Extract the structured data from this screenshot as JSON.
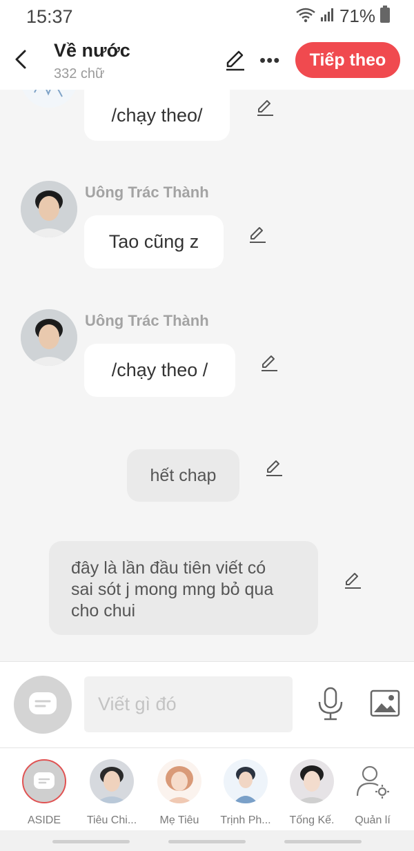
{
  "status": {
    "time": "15:37",
    "battery": "71%"
  },
  "header": {
    "title": "Về nước",
    "subtitle": "332 chữ",
    "next_label": "Tiếp theo"
  },
  "messages": [
    {
      "text": "/chạy theo/"
    },
    {
      "sender": "Uông Trác Thành",
      "text": "Tao cũng z"
    },
    {
      "sender": "Uông Trác Thành",
      "text": "/chạy theo /"
    },
    {
      "text": "hết chap"
    },
    {
      "text": "đây là lần đầu tiên viết có\nsai sót j mong mng bỏ qua\ncho chui"
    }
  ],
  "composer": {
    "placeholder": "Viết gì đó"
  },
  "tabs": [
    {
      "label": "ASIDE"
    },
    {
      "label": "Tiêu Chi..."
    },
    {
      "label": "Mẹ Tiêu"
    },
    {
      "label": "Trịnh Ph..."
    },
    {
      "label": "Tống Kế."
    },
    {
      "label": "Quản lí"
    }
  ],
  "colors": {
    "accent": "#f04a4f",
    "background": "#f5f5f5",
    "bubble": "#ffffff",
    "narration": "#eaeaea"
  },
  "icons": [
    "back-icon",
    "pencil-icon",
    "more-icon",
    "wifi-icon",
    "signal-icon",
    "battery-icon",
    "chat-bubble-icon",
    "microphone-icon",
    "image-icon",
    "user-settings-icon"
  ]
}
